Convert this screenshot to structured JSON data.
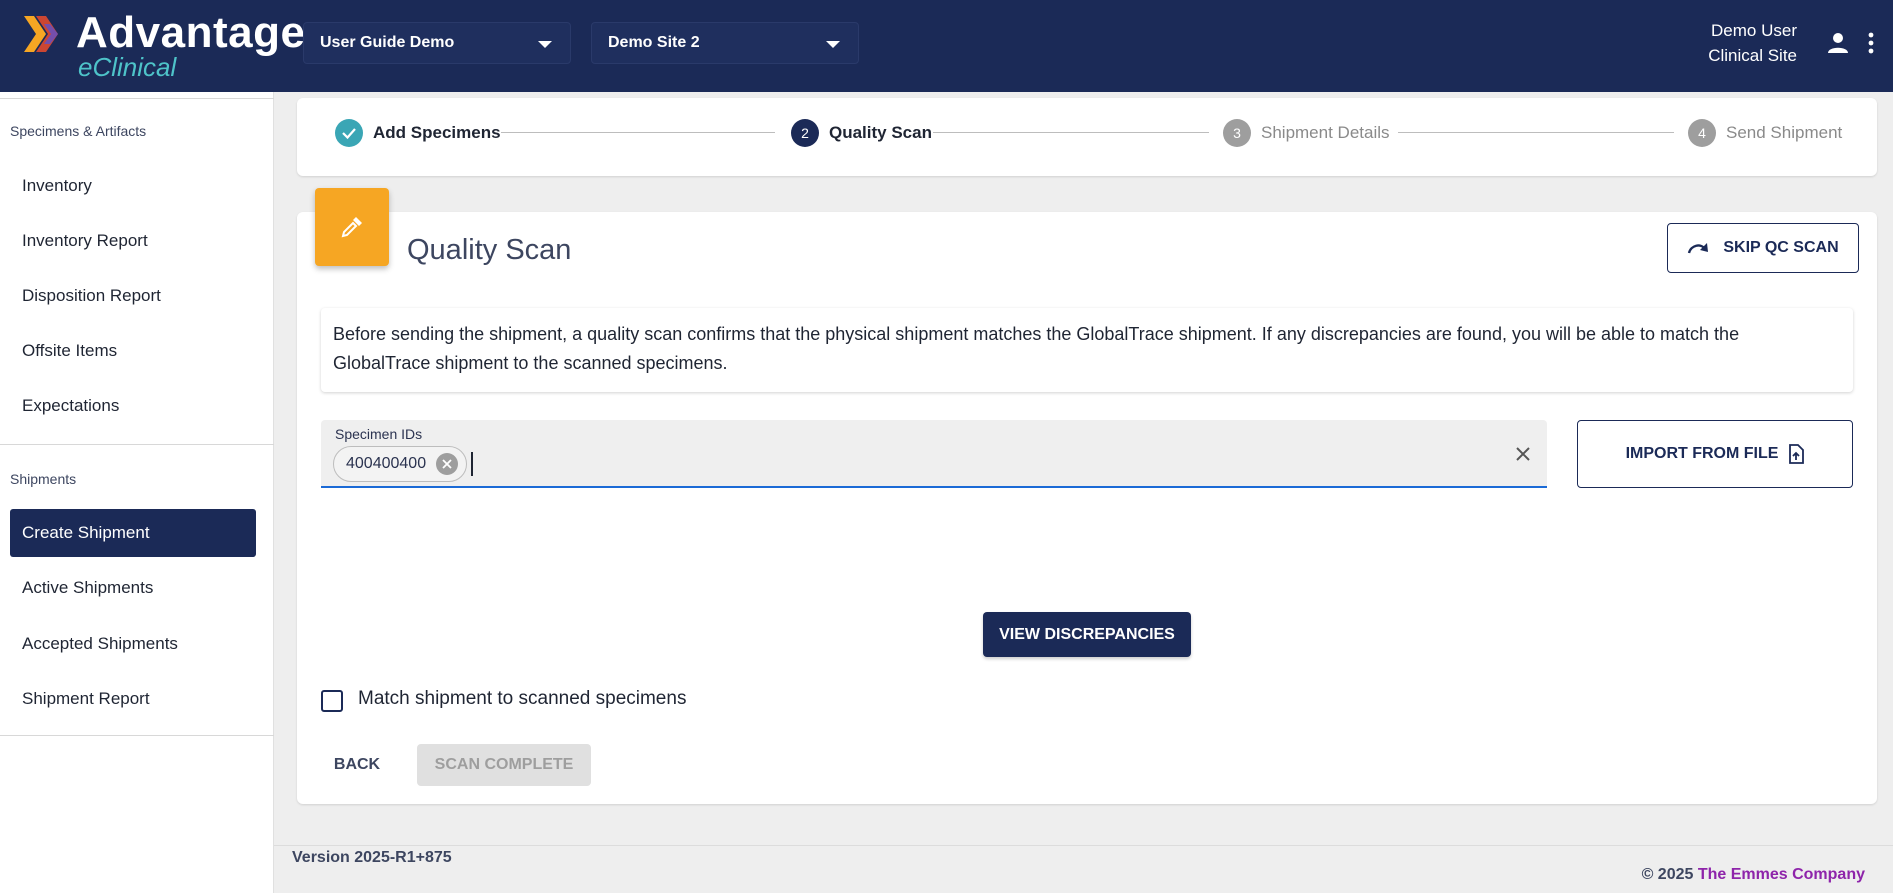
{
  "header": {
    "logo_title": "Advantage",
    "logo_subtitle": "eClinical",
    "study_selector": "User Guide Demo",
    "site_selector": "Demo Site 2",
    "user_name": "Demo User",
    "user_role": "Clinical Site",
    "icons": [
      "user-icon",
      "kebab-menu-icon",
      "dropdown-caret-icon"
    ]
  },
  "sidebar": {
    "sections": [
      {
        "title": "Specimens & Artifacts",
        "items": [
          "Inventory",
          "Inventory Report",
          "Disposition Report",
          "Offsite Items",
          "Expectations"
        ]
      },
      {
        "title": "Shipments",
        "items": [
          "Create Shipment",
          "Active Shipments",
          "Accepted Shipments",
          "Shipment Report"
        ]
      }
    ],
    "active_item": "Create Shipment"
  },
  "stepper": {
    "steps": [
      {
        "number": "",
        "label": "Add Specimens",
        "state": "complete"
      },
      {
        "number": "2",
        "label": "Quality Scan",
        "state": "active"
      },
      {
        "number": "3",
        "label": "Shipment Details",
        "state": "pending"
      },
      {
        "number": "4",
        "label": "Send Shipment",
        "state": "pending"
      }
    ]
  },
  "main": {
    "title": "Quality Scan",
    "skip_button": "SKIP QC SCAN",
    "info_text": "Before sending the shipment, a quality scan confirms that the physical shipment matches the GlobalTrace shipment. If any discrepancies are found, you will be able to match the GlobalTrace shipment to the scanned specimens.",
    "specimen_field_label": "Specimen IDs",
    "specimen_chips": [
      "400400400"
    ],
    "import_button": "IMPORT FROM FILE",
    "view_discrepancies_button": "VIEW DISCREPANCIES",
    "match_checkbox_label": "Match shipment to scanned specimens",
    "match_checked": false,
    "back_button": "BACK",
    "scan_complete_button": "SCAN COMPLETE"
  },
  "footer": {
    "version": "Version 2025-R1+875",
    "copyright_prefix": "© 2025 ",
    "company": "The Emmes Company"
  },
  "colors": {
    "brand_navy": "#1b2a57",
    "accent_orange": "#f6a623",
    "complete_teal": "#3aa6b5",
    "pending_gray": "#9e9e9e",
    "input_underline": "#1b6ad6",
    "company_purple": "#8e24aa"
  }
}
